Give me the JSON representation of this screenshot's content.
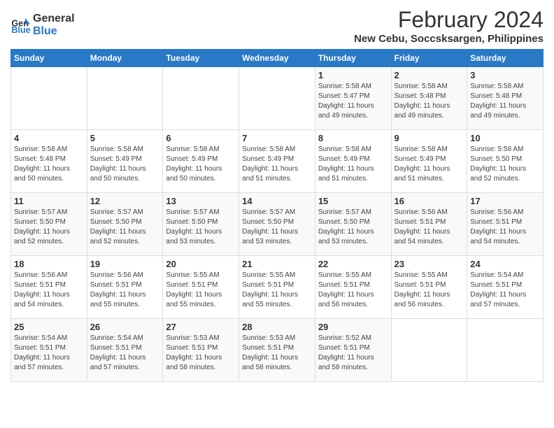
{
  "logo": {
    "line1": "General",
    "line2": "Blue"
  },
  "title": "February 2024",
  "subtitle": "New Cebu, Soccsksargen, Philippines",
  "days_of_week": [
    "Sunday",
    "Monday",
    "Tuesday",
    "Wednesday",
    "Thursday",
    "Friday",
    "Saturday"
  ],
  "weeks": [
    [
      {
        "num": "",
        "info": ""
      },
      {
        "num": "",
        "info": ""
      },
      {
        "num": "",
        "info": ""
      },
      {
        "num": "",
        "info": ""
      },
      {
        "num": "1",
        "info": "Sunrise: 5:58 AM\nSunset: 5:47 PM\nDaylight: 11 hours\nand 49 minutes."
      },
      {
        "num": "2",
        "info": "Sunrise: 5:58 AM\nSunset: 5:48 PM\nDaylight: 11 hours\nand 49 minutes."
      },
      {
        "num": "3",
        "info": "Sunrise: 5:58 AM\nSunset: 5:48 PM\nDaylight: 11 hours\nand 49 minutes."
      }
    ],
    [
      {
        "num": "4",
        "info": "Sunrise: 5:58 AM\nSunset: 5:48 PM\nDaylight: 11 hours\nand 50 minutes."
      },
      {
        "num": "5",
        "info": "Sunrise: 5:58 AM\nSunset: 5:49 PM\nDaylight: 11 hours\nand 50 minutes."
      },
      {
        "num": "6",
        "info": "Sunrise: 5:58 AM\nSunset: 5:49 PM\nDaylight: 11 hours\nand 50 minutes."
      },
      {
        "num": "7",
        "info": "Sunrise: 5:58 AM\nSunset: 5:49 PM\nDaylight: 11 hours\nand 51 minutes."
      },
      {
        "num": "8",
        "info": "Sunrise: 5:58 AM\nSunset: 5:49 PM\nDaylight: 11 hours\nand 51 minutes."
      },
      {
        "num": "9",
        "info": "Sunrise: 5:58 AM\nSunset: 5:49 PM\nDaylight: 11 hours\nand 51 minutes."
      },
      {
        "num": "10",
        "info": "Sunrise: 5:58 AM\nSunset: 5:50 PM\nDaylight: 11 hours\nand 52 minutes."
      }
    ],
    [
      {
        "num": "11",
        "info": "Sunrise: 5:57 AM\nSunset: 5:50 PM\nDaylight: 11 hours\nand 52 minutes."
      },
      {
        "num": "12",
        "info": "Sunrise: 5:57 AM\nSunset: 5:50 PM\nDaylight: 11 hours\nand 52 minutes."
      },
      {
        "num": "13",
        "info": "Sunrise: 5:57 AM\nSunset: 5:50 PM\nDaylight: 11 hours\nand 53 minutes."
      },
      {
        "num": "14",
        "info": "Sunrise: 5:57 AM\nSunset: 5:50 PM\nDaylight: 11 hours\nand 53 minutes."
      },
      {
        "num": "15",
        "info": "Sunrise: 5:57 AM\nSunset: 5:50 PM\nDaylight: 11 hours\nand 53 minutes."
      },
      {
        "num": "16",
        "info": "Sunrise: 5:56 AM\nSunset: 5:51 PM\nDaylight: 11 hours\nand 54 minutes."
      },
      {
        "num": "17",
        "info": "Sunrise: 5:56 AM\nSunset: 5:51 PM\nDaylight: 11 hours\nand 54 minutes."
      }
    ],
    [
      {
        "num": "18",
        "info": "Sunrise: 5:56 AM\nSunset: 5:51 PM\nDaylight: 11 hours\nand 54 minutes."
      },
      {
        "num": "19",
        "info": "Sunrise: 5:56 AM\nSunset: 5:51 PM\nDaylight: 11 hours\nand 55 minutes."
      },
      {
        "num": "20",
        "info": "Sunrise: 5:55 AM\nSunset: 5:51 PM\nDaylight: 11 hours\nand 55 minutes."
      },
      {
        "num": "21",
        "info": "Sunrise: 5:55 AM\nSunset: 5:51 PM\nDaylight: 11 hours\nand 55 minutes."
      },
      {
        "num": "22",
        "info": "Sunrise: 5:55 AM\nSunset: 5:51 PM\nDaylight: 11 hours\nand 56 minutes."
      },
      {
        "num": "23",
        "info": "Sunrise: 5:55 AM\nSunset: 5:51 PM\nDaylight: 11 hours\nand 56 minutes."
      },
      {
        "num": "24",
        "info": "Sunrise: 5:54 AM\nSunset: 5:51 PM\nDaylight: 11 hours\nand 57 minutes."
      }
    ],
    [
      {
        "num": "25",
        "info": "Sunrise: 5:54 AM\nSunset: 5:51 PM\nDaylight: 11 hours\nand 57 minutes."
      },
      {
        "num": "26",
        "info": "Sunrise: 5:54 AM\nSunset: 5:51 PM\nDaylight: 11 hours\nand 57 minutes."
      },
      {
        "num": "27",
        "info": "Sunrise: 5:53 AM\nSunset: 5:51 PM\nDaylight: 11 hours\nand 58 minutes."
      },
      {
        "num": "28",
        "info": "Sunrise: 5:53 AM\nSunset: 5:51 PM\nDaylight: 11 hours\nand 58 minutes."
      },
      {
        "num": "29",
        "info": "Sunrise: 5:52 AM\nSunset: 5:51 PM\nDaylight: 11 hours\nand 58 minutes."
      },
      {
        "num": "",
        "info": ""
      },
      {
        "num": "",
        "info": ""
      }
    ]
  ]
}
